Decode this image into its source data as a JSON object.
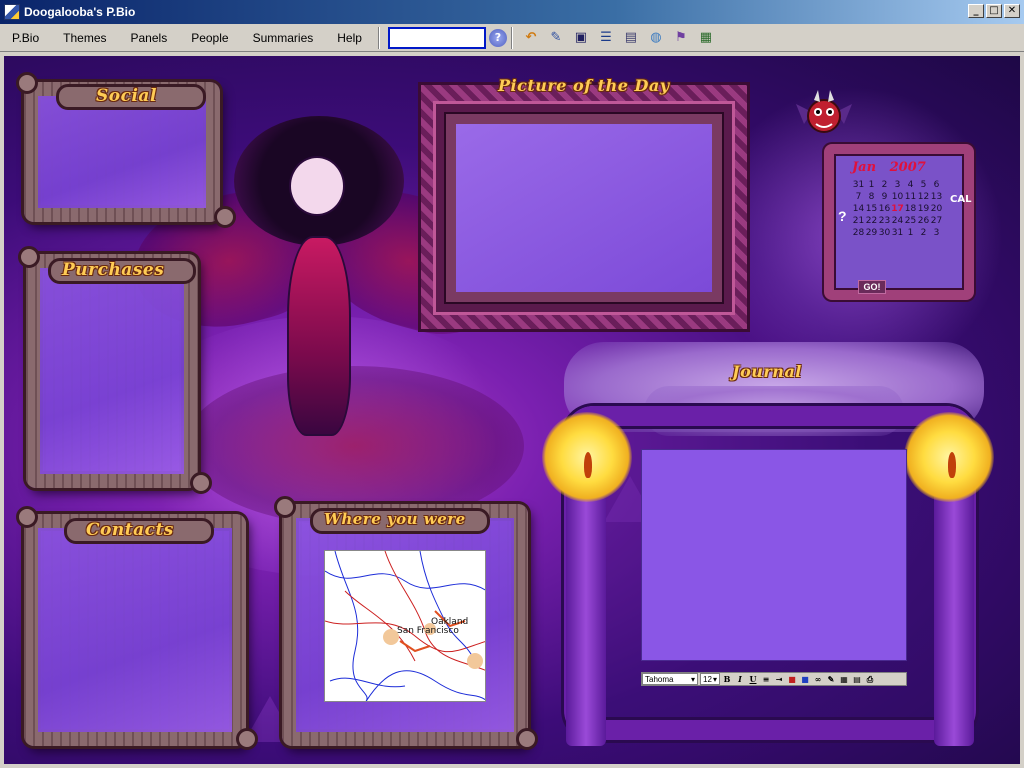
{
  "window": {
    "title": "Doogalooba's P.Bio",
    "controls": [
      "_",
      "□",
      "✕"
    ]
  },
  "menu": {
    "items": [
      {
        "label": "P.Bio"
      },
      {
        "label": "Themes"
      },
      {
        "label": "Panels"
      },
      {
        "label": "People"
      },
      {
        "label": "Summaries"
      },
      {
        "label": "Help"
      }
    ]
  },
  "toolbar": {
    "search": {
      "value": "",
      "placeholder": ""
    },
    "icons": [
      {
        "name": "search-help-icon",
        "glyph": "?"
      },
      {
        "name": "undo-icon",
        "glyph": "↶"
      },
      {
        "name": "edit-icon",
        "glyph": "✎"
      },
      {
        "name": "save-icon",
        "glyph": "▣"
      },
      {
        "name": "layout-icon",
        "glyph": "☰"
      },
      {
        "name": "notes-icon",
        "glyph": "▤"
      },
      {
        "name": "globe-icon",
        "glyph": "◍"
      },
      {
        "name": "flag-icon",
        "glyph": "⚑"
      },
      {
        "name": "picture-icon",
        "glyph": "▦"
      }
    ]
  },
  "panels": {
    "social": {
      "title": "Social"
    },
    "purchases": {
      "title": "Purchases"
    },
    "contacts": {
      "title": "Contacts"
    },
    "where_you_were": {
      "title": "Where you were"
    },
    "picture_of_the_day": {
      "title": "Picture of the Day"
    },
    "journal": {
      "title": "Journal"
    }
  },
  "map": {
    "labels": [
      "Oakland",
      "San Francisco"
    ]
  },
  "calendar": {
    "month": "Jan",
    "year": "2007",
    "side_label": "CAL",
    "help": "?",
    "go": "GO!",
    "days": [
      [
        "31",
        "1",
        "2",
        "3",
        "4",
        "5",
        "6"
      ],
      [
        "7",
        "8",
        "9",
        "10",
        "11",
        "12",
        "13"
      ],
      [
        "14",
        "15",
        "16",
        "17",
        "18",
        "19",
        "20"
      ],
      [
        "21",
        "22",
        "23",
        "24",
        "25",
        "26",
        "27"
      ],
      [
        "28",
        "29",
        "30",
        "31",
        "1",
        "2",
        "3"
      ]
    ],
    "today": "17"
  },
  "journal_editor": {
    "font": "Tahoma",
    "size": "12",
    "buttons": [
      "B",
      "I",
      "U"
    ]
  }
}
